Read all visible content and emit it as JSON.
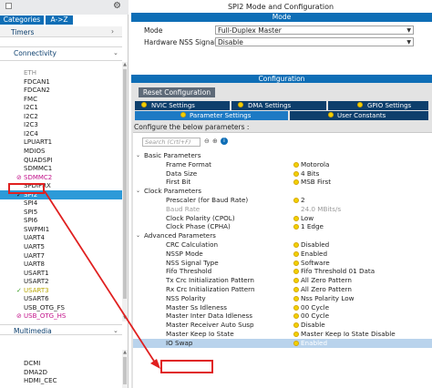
{
  "left": {
    "tabs": {
      "categories": "Categories",
      "az": "A->Z"
    },
    "timers_label": "Timers",
    "connectivity_label": "Connectivity",
    "multimedia_label": "Multimedia",
    "peripherals": [
      {
        "label": "ETH",
        "state": "disabled",
        "mark": ""
      },
      {
        "label": "FDCAN1",
        "state": "normal",
        "mark": ""
      },
      {
        "label": "FDCAN2",
        "state": "normal",
        "mark": ""
      },
      {
        "label": "FMC",
        "state": "normal",
        "mark": ""
      },
      {
        "label": "I2C1",
        "state": "normal",
        "mark": ""
      },
      {
        "label": "I2C2",
        "state": "normal",
        "mark": ""
      },
      {
        "label": "I2C3",
        "state": "normal",
        "mark": ""
      },
      {
        "label": "I2C4",
        "state": "normal",
        "mark": ""
      },
      {
        "label": "LPUART1",
        "state": "normal",
        "mark": ""
      },
      {
        "label": "MDIOS",
        "state": "normal",
        "mark": ""
      },
      {
        "label": "QUADSPI",
        "state": "normal",
        "mark": ""
      },
      {
        "label": "SDMMC1",
        "state": "normal",
        "mark": ""
      },
      {
        "label": "SDMMC2",
        "state": "magenta",
        "mark": "⊘"
      },
      {
        "label": "SPDIFRX",
        "state": "normal",
        "mark": ""
      },
      {
        "label": "SPI2",
        "state": "selected",
        "mark": "✓"
      },
      {
        "label": "SPI4",
        "state": "normal",
        "mark": ""
      },
      {
        "label": "SPI5",
        "state": "normal",
        "mark": ""
      },
      {
        "label": "SPI6",
        "state": "normal",
        "mark": ""
      },
      {
        "label": "SWPMI1",
        "state": "normal",
        "mark": ""
      },
      {
        "label": "UART4",
        "state": "normal",
        "mark": ""
      },
      {
        "label": "UART5",
        "state": "normal",
        "mark": ""
      },
      {
        "label": "UART7",
        "state": "normal",
        "mark": ""
      },
      {
        "label": "UART8",
        "state": "normal",
        "mark": ""
      },
      {
        "label": "USART1",
        "state": "normal",
        "mark": ""
      },
      {
        "label": "USART2",
        "state": "normal",
        "mark": ""
      },
      {
        "label": "USART3",
        "state": "green",
        "mark": "✓"
      },
      {
        "label": "USART6",
        "state": "normal",
        "mark": ""
      },
      {
        "label": "USB_OTG_FS",
        "state": "normal",
        "mark": ""
      },
      {
        "label": "USB_OTG_HS",
        "state": "magenta",
        "mark": "⊘"
      }
    ],
    "multimedia_items": [
      {
        "label": "DCMI"
      },
      {
        "label": "DMA2D"
      },
      {
        "label": "HDMI_CEC"
      }
    ]
  },
  "right": {
    "title": "SPI2 Mode and Configuration",
    "mode_band": "Mode",
    "mode_label": "Mode",
    "mode_value": "Full-Duplex Master",
    "nss_label": "Hardware NSS Signal",
    "nss_value": "Disable",
    "config_band": "Configuration",
    "reset_button": "Reset Configuration",
    "tabs": {
      "nvic": "NVIC Settings",
      "dma": "DMA Settings",
      "gpio": "GPIO Settings",
      "params": "Parameter Settings",
      "user": "User Constants"
    },
    "configure_label": "Configure the below parameters :",
    "search_placeholder": "Search (Crtl+F)",
    "groups": [
      {
        "name": "Basic Parameters",
        "rows": [
          {
            "name": "Frame Format",
            "value": "Motorola",
            "muted": false
          },
          {
            "name": "Data Size",
            "value": "4 Bits",
            "muted": false
          },
          {
            "name": "First Bit",
            "value": "MSB First",
            "muted": false
          }
        ]
      },
      {
        "name": "Clock Parameters",
        "rows": [
          {
            "name": "Prescaler (for Baud Rate)",
            "value": "2",
            "muted": false
          },
          {
            "name": "Baud Rate",
            "value": "24.0 MBits/s",
            "muted": true
          },
          {
            "name": "Clock Polarity (CPOL)",
            "value": "Low",
            "muted": false
          },
          {
            "name": "Clock Phase (CPHA)",
            "value": "1 Edge",
            "muted": false
          }
        ]
      },
      {
        "name": "Advanced Parameters",
        "rows": [
          {
            "name": "CRC Calculation",
            "value": "Disabled",
            "muted": false
          },
          {
            "name": "NSSP Mode",
            "value": "Enabled",
            "muted": false
          },
          {
            "name": "NSS Signal Type",
            "value": "Software",
            "muted": false
          },
          {
            "name": "Fifo Threshold",
            "value": "Fifo Threshold 01 Data",
            "muted": false
          },
          {
            "name": "Tx Crc Initialization Pattern",
            "value": "All Zero Pattern",
            "muted": false
          },
          {
            "name": "Rx Crc Initialization Pattern",
            "value": "All Zero Pattern",
            "muted": false
          },
          {
            "name": "NSS Polarity",
            "value": "Nss Polarity Low",
            "muted": false
          },
          {
            "name": "Master Ss Idleness",
            "value": "00 Cycle",
            "muted": false
          },
          {
            "name": "Master Inter Data Idleness",
            "value": "00 Cycle",
            "muted": false
          },
          {
            "name": "Master Receiver Auto Susp",
            "value": "Disable",
            "muted": false
          },
          {
            "name": "Master Keep Io State",
            "value": "Master Keep Io State Disable",
            "muted": false
          },
          {
            "name": "IO Swap",
            "value": "Enabled",
            "muted": false,
            "highlight": true
          }
        ]
      }
    ]
  },
  "colors": {
    "brand_blue": "#0e6eb6",
    "tab_dark": "#0e3f6c",
    "selection": "#2d9ad8",
    "callout_red": "#e02020",
    "warning_dot": "#f2d100"
  }
}
